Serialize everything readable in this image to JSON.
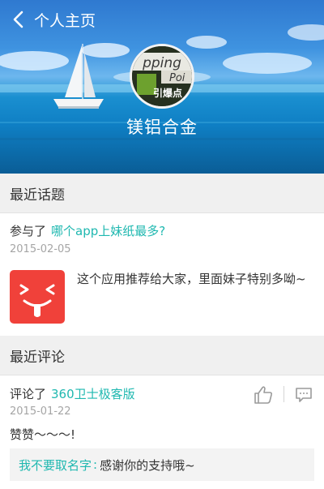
{
  "header": {
    "title": "个人主页",
    "back_icon": "chevron-left-icon",
    "background": "sailboat-ocean-photo"
  },
  "profile": {
    "username": "镁铝合金",
    "avatar": {
      "image": "book-cover-avatar",
      "text_top": "pping",
      "text_mid": "Poi",
      "text_bottom": "引爆点"
    }
  },
  "recent_topics": {
    "title": "最近话题",
    "item": {
      "prefix": "参与了",
      "topic_link": "哪个app上妹纸最多?",
      "date": "2015-02-05",
      "icon": "red-face-app-icon",
      "content": "这个应用推荐给大家，里面妹子特别多呦~"
    }
  },
  "recent_comments": {
    "title": "最近评论",
    "item": {
      "prefix": "评论了",
      "target_link": "360卫士极客版",
      "date": "2015-01-22",
      "content": "赞赞～～～!",
      "like_icon": "thumbs-up-icon",
      "comment_icon": "comment-bubble-icon",
      "reply": {
        "name": "我不要取名字",
        "colon": ":",
        "text": "感谢你的支持哦~"
      }
    }
  },
  "colors": {
    "link": "#1fb8b0",
    "section_bg": "#f0f0f0",
    "date": "#a5a5a5",
    "app_icon": "#f0413a"
  }
}
